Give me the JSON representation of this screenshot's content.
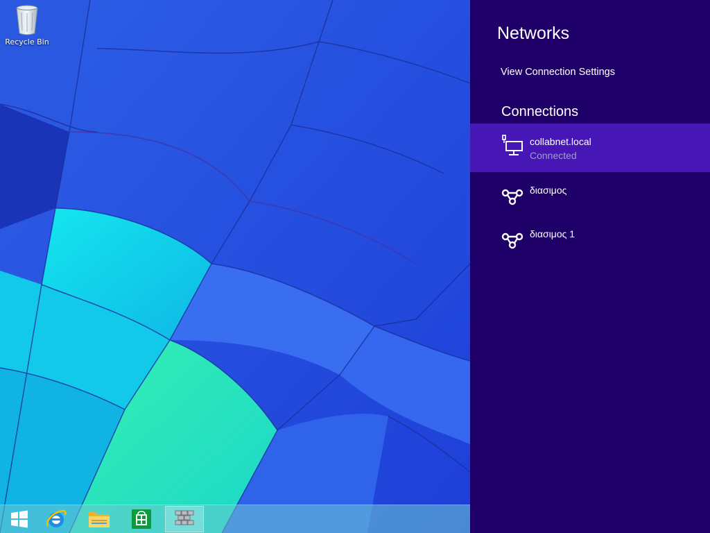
{
  "desktop": {
    "icons": [
      {
        "label": "Recycle Bin",
        "icon": "recycle-bin-icon"
      }
    ]
  },
  "taskbar": {
    "items": [
      {
        "name": "start-button",
        "icon": "windows-logo-icon"
      },
      {
        "name": "internet-explorer",
        "icon": "internet-explorer-icon"
      },
      {
        "name": "file-explorer",
        "icon": "folder-icon"
      },
      {
        "name": "store",
        "icon": "store-bag-icon"
      },
      {
        "name": "firewall-app",
        "icon": "brick-wall-icon",
        "active": true
      }
    ]
  },
  "charm": {
    "title": "Networks",
    "view_settings_link": "View Connection Settings",
    "connections_heading": "Connections",
    "connections": [
      {
        "name": "collabnet.local",
        "status": "Connected",
        "icon": "wired-network-icon",
        "selected": true
      },
      {
        "name": "διασιμος",
        "status": "",
        "icon": "vpn-connection-icon",
        "selected": false
      },
      {
        "name": "διασιμος 1",
        "status": "",
        "icon": "vpn-connection-icon",
        "selected": false
      }
    ]
  },
  "colors": {
    "charm_background": "#1f0068",
    "selected_item": "#4617b4",
    "status_text": "#a49ad0"
  }
}
